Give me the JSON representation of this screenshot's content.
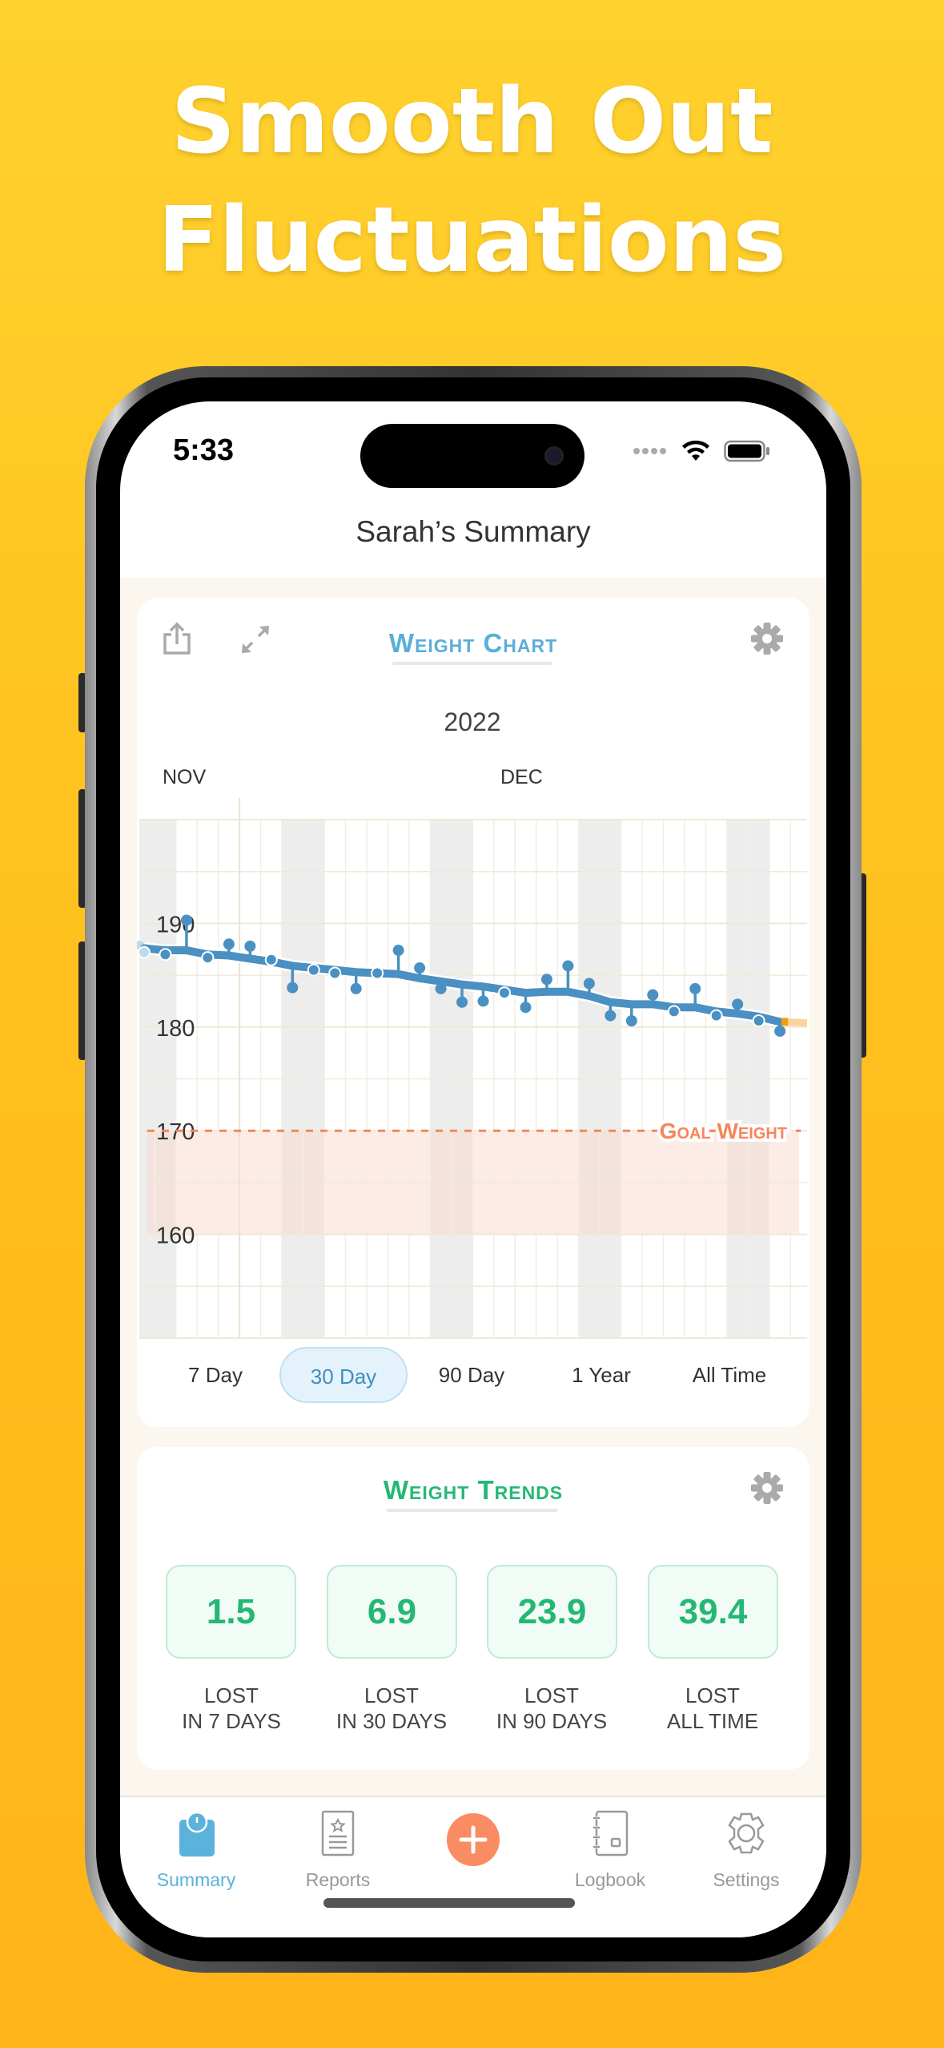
{
  "headline": {
    "line1": "Smooth Out",
    "line2": "Fluctuations"
  },
  "status_bar": {
    "time": "5:33"
  },
  "nav": {
    "title": "Sarah’s Summary"
  },
  "weight_chart": {
    "title": "Weight Chart",
    "accent": "#4A90C2",
    "ranges": [
      "7 Day",
      "30 Day",
      "90 Day",
      "1 Year",
      "All Time"
    ],
    "selected_range": "30 Day",
    "goal_label": "Goal Weight"
  },
  "chart_data": {
    "type": "line",
    "year_label": "2022",
    "month_labels": [
      "NOV",
      "DEC"
    ],
    "x": [
      "2022-11-19",
      "2022-11-20",
      "2022-11-21",
      "2022-11-22",
      "2022-11-23",
      "2022-11-24",
      "2022-11-25",
      "2022-11-26",
      "2022-11-27",
      "2022-11-28",
      "2022-11-29",
      "2022-11-30",
      "2022-12-01",
      "2022-12-02",
      "2022-12-03",
      "2022-12-04",
      "2022-12-05",
      "2022-12-06",
      "2022-12-07",
      "2022-12-08",
      "2022-12-09",
      "2022-12-10",
      "2022-12-11",
      "2022-12-12",
      "2022-12-13",
      "2022-12-14",
      "2022-12-15",
      "2022-12-16",
      "2022-12-17",
      "2022-12-18",
      "2022-12-19"
    ],
    "series": [
      {
        "kind": "weigh-ins",
        "color": "#4A90C2",
        "values": [
          187.2,
          187.0,
          190.3,
          186.7,
          188.0,
          187.8,
          186.5,
          183.8,
          185.5,
          185.2,
          183.7,
          185.2,
          187.4,
          185.7,
          183.7,
          182.4,
          182.5,
          183.3,
          181.9,
          184.6,
          185.9,
          184.2,
          181.1,
          180.6,
          183.1,
          181.5,
          183.7,
          181.1,
          182.2,
          180.6,
          179.6
        ]
      },
      {
        "kind": "trend",
        "color": "#4A90C2",
        "values": [
          187.6,
          187.4,
          187.4,
          187.0,
          186.9,
          186.6,
          186.3,
          185.9,
          185.7,
          185.5,
          185.3,
          185.2,
          185.1,
          184.7,
          184.4,
          184.1,
          183.9,
          183.6,
          183.3,
          183.4,
          183.4,
          183.0,
          182.4,
          182.2,
          182.2,
          181.9,
          181.9,
          181.5,
          181.3,
          181.0,
          180.5
        ]
      }
    ],
    "goal": 170,
    "goal_color": "#F5865A",
    "y_ticks": [
      160,
      170,
      180,
      190
    ],
    "ylim": [
      150,
      200
    ],
    "grid": true,
    "weekend_shading": true
  },
  "weight_trends": {
    "title": "Weight Trends",
    "accent": "#24B874",
    "items": [
      {
        "value": "1.5",
        "label1": "LOST",
        "label2": "IN 7 DAYS"
      },
      {
        "value": "6.9",
        "label1": "LOST",
        "label2": "IN 30 DAYS"
      },
      {
        "value": "23.9",
        "label1": "LOST",
        "label2": "IN 90 DAYS"
      },
      {
        "value": "39.4",
        "label1": "LOST",
        "label2": "ALL TIME"
      }
    ]
  },
  "tabbar": {
    "items": [
      {
        "label": "Summary",
        "icon": "scale-icon",
        "active": true
      },
      {
        "label": "Reports",
        "icon": "report-icon"
      },
      {
        "label": "",
        "icon": "add-icon"
      },
      {
        "label": "Logbook",
        "icon": "logbook-icon"
      },
      {
        "label": "Settings",
        "icon": "gear-icon"
      }
    ],
    "active_color": "#5BB2DA",
    "add_color": "#F98C62"
  }
}
